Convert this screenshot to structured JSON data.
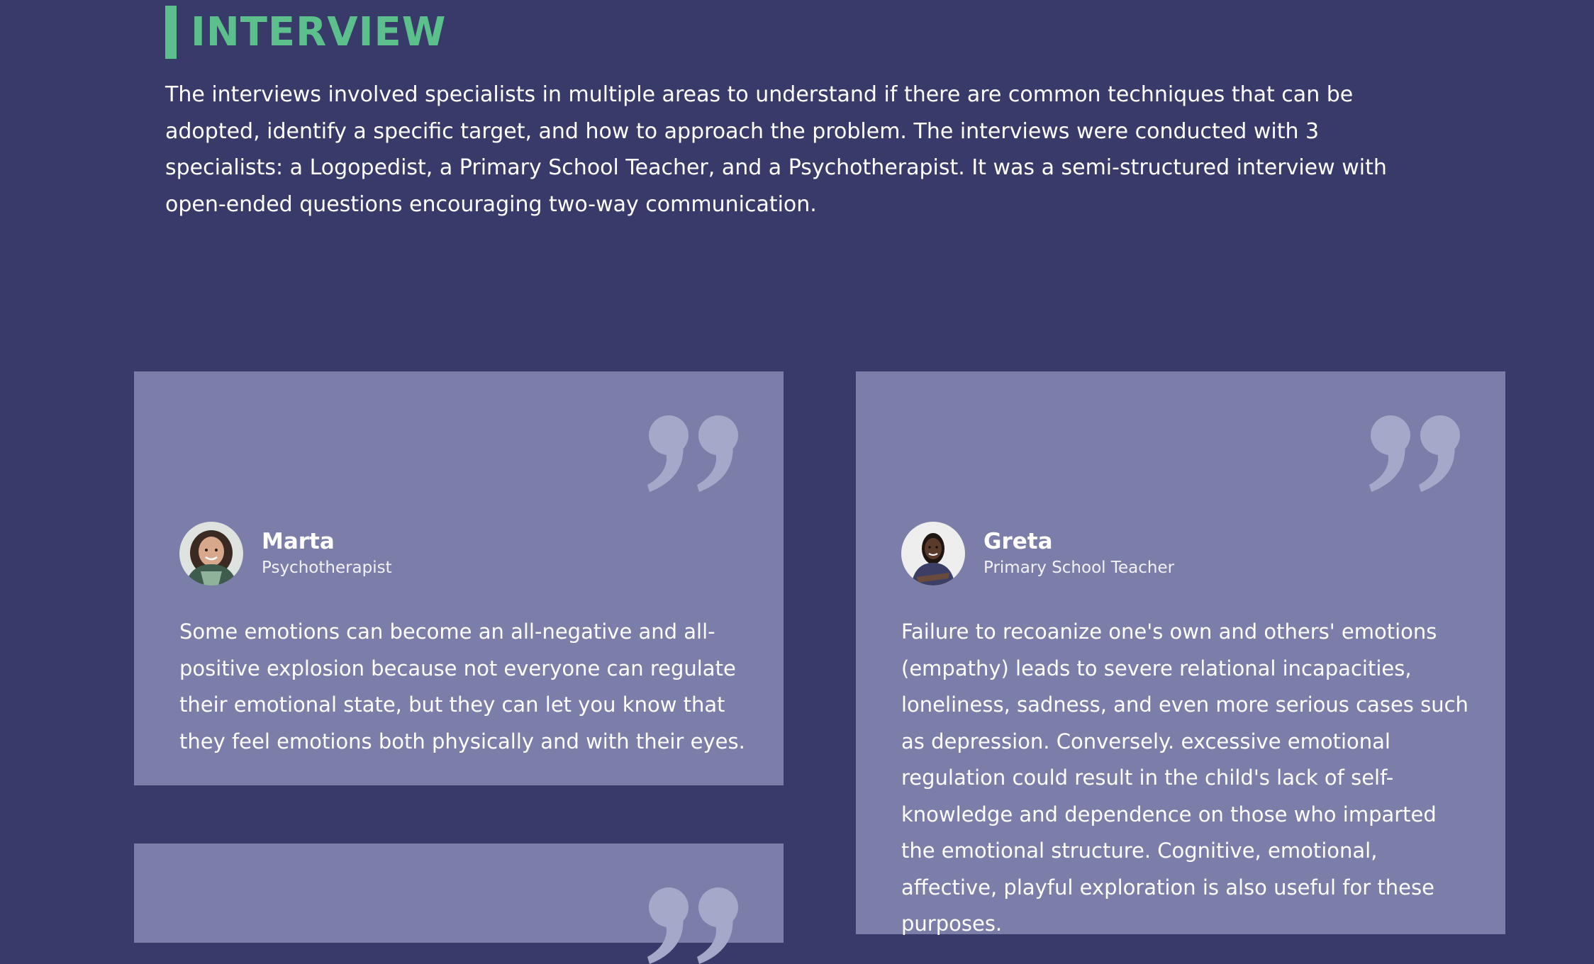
{
  "section": {
    "title": "INTERVIEW",
    "intro": "The interviews involved specialists in multiple areas to understand if there are common techniques that can be adopted, identify a specific target, and how to approach the problem. The interviews were conducted with 3 specialists: a Logopedist, a Primary School Teacher, and a Psychotherapist. It was a semi-structured interview with open-ended questions encouraging two-way communication."
  },
  "colors": {
    "background": "#383b69",
    "accent": "#5bc08c",
    "card": "#7a7ea9",
    "quote_mark": "#a5a8c8"
  },
  "testimonials": [
    {
      "name": "Marta",
      "role": "Psychotherapist",
      "quote": "Some emotions can become an all-negative and all-positive explosion because not everyone can regulate their emotional state, but they can let you know that they feel emotions both physically and with their eyes.",
      "avatar_icon": "avatar-photo-icon"
    },
    {
      "name": "Greta",
      "role": "Primary School Teacher",
      "quote": "Failure to recoanize one's own and others' emotions (empathy) leads to severe relational incapacities, loneliness, sadness, and even more serious cases such as depression. Conversely. excessive emotional regulation could result in the child's lack of self-knowledge and dependence on those who imparted the emotional structure. Cognitive, emotional, affective, playful exploration is also useful for these purposes.",
      "avatar_icon": "avatar-photo-icon"
    }
  ],
  "icons": {
    "quote": "quote-mark-icon"
  }
}
